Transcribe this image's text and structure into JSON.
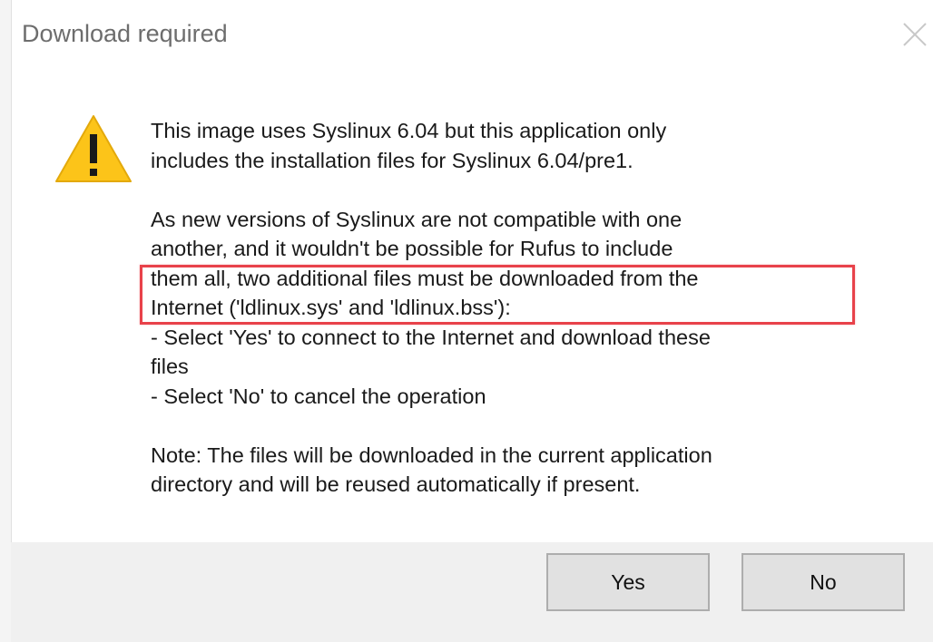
{
  "dialog": {
    "title": "Download required",
    "close_icon": "close-icon",
    "warning_icon": "warning-icon",
    "warning_color": "#fcc419",
    "highlight_color": "#e8424a",
    "message_lines": [
      "This image uses Syslinux 6.04 but this application only",
      "includes the installation files for Syslinux 6.04/pre1.",
      "",
      "As new versions of Syslinux are not compatible with one",
      "another, and it wouldn't be possible for Rufus to include",
      "them all, two additional files must be downloaded from the",
      "Internet ('ldlinux.sys' and 'ldlinux.bss'):",
      "- Select 'Yes' to connect to the Internet and download these",
      "files",
      "- Select 'No' to cancel the operation",
      "",
      "Note: The files will be downloaded in the current application",
      "directory and will be reused automatically if present."
    ],
    "buttons": {
      "yes_label": "Yes",
      "no_label": "No"
    }
  }
}
